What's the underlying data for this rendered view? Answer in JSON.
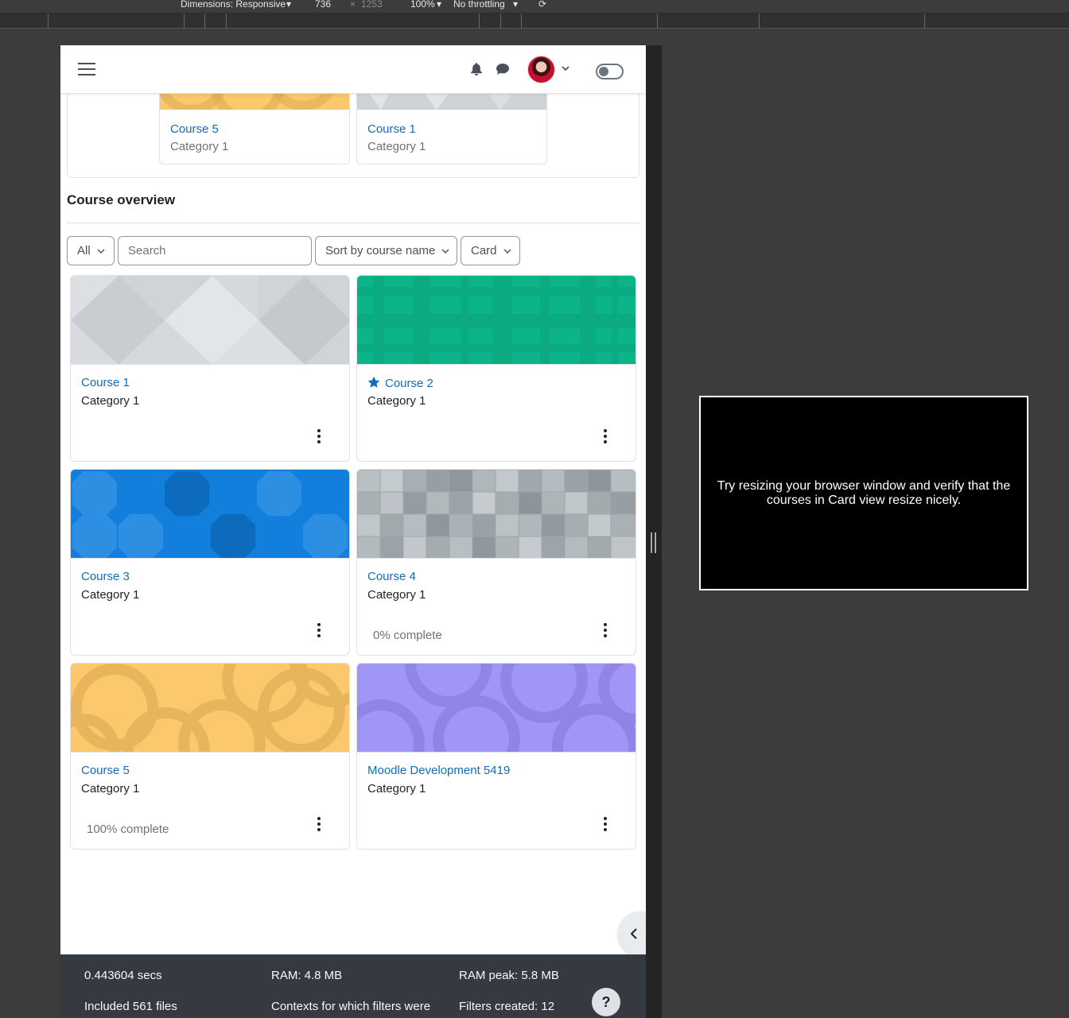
{
  "devtools": {
    "dimensions_label": "Dimensions: Responsive",
    "width": "736",
    "times": "×",
    "height": "1253",
    "zoom": "100%",
    "throttling": "No throttling"
  },
  "navbar": {
    "menu_icon": "hamburger-icon",
    "notifications_icon": "bell-icon",
    "messages_icon": "chat-icon",
    "user_menu_icon": "chevron-down-icon"
  },
  "recent": [
    {
      "title": "Course 5",
      "category": "Category 1",
      "image_color": "#fbc86b"
    },
    {
      "title": "Course 1",
      "category": "Category 1",
      "image_color": "#ced3d7"
    }
  ],
  "overview": {
    "heading": "Course overview",
    "filter_all": "All",
    "search_placeholder": "Search",
    "sort_label": "Sort by course name",
    "view_label": "Card"
  },
  "courses": [
    {
      "title": "Course 1",
      "category": "Category 1",
      "progress": "",
      "starred": false,
      "image_color": "#d0d4d8",
      "pattern": "hex"
    },
    {
      "title": "Course 2",
      "category": "Category 1",
      "progress": "",
      "starred": true,
      "image_color": "#0cb48a",
      "pattern": "plaid"
    },
    {
      "title": "Course 3",
      "category": "Category 1",
      "progress": "",
      "starred": false,
      "image_color": "#137fdc",
      "pattern": "octagon"
    },
    {
      "title": "Course 4",
      "category": "Category 1",
      "progress": "0% complete",
      "starred": false,
      "image_color": "#aab2b7",
      "pattern": "squares"
    },
    {
      "title": "Course 5",
      "category": "Category 1",
      "progress": "100% complete",
      "starred": false,
      "image_color": "#fbc86b",
      "pattern": "circles"
    },
    {
      "title": "Moodle Development 5419",
      "category": "Category 1",
      "progress": "",
      "starred": false,
      "image_color": "#a096f5",
      "pattern": "circles"
    }
  ],
  "footer": {
    "time": "0.443604 secs",
    "ram": "RAM: 4.8 MB",
    "ram_peak": "RAM peak: 5.8 MB",
    "files": "Included 561 files",
    "contexts": "Contexts for which filters were",
    "filters": "Filters created: 12",
    "help": "?"
  },
  "tip": {
    "text": "Try resizing your browser window and verify that the courses in Card view resize nicely."
  },
  "colors": {
    "link": "#0f6cbf",
    "text": "#1d2125",
    "muted": "#6a737b",
    "footer_bg": "#343a40"
  }
}
